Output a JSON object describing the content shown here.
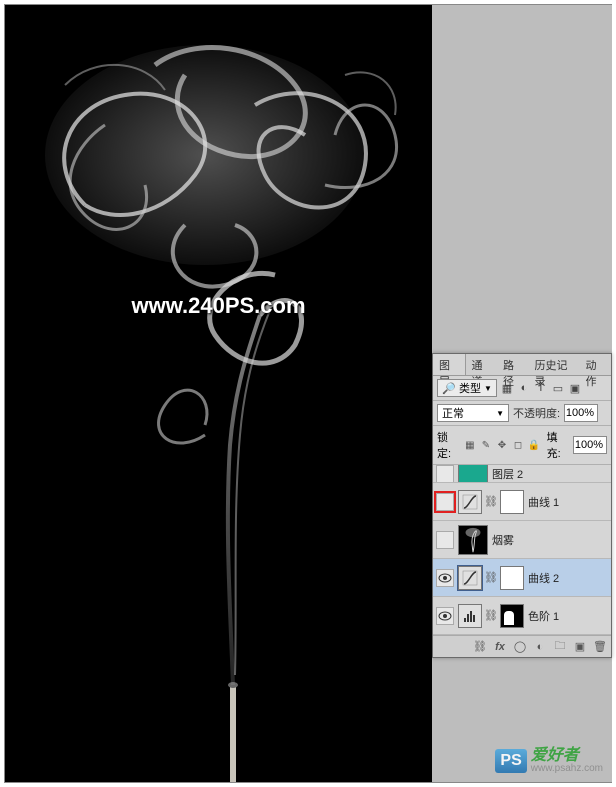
{
  "watermark": "www.240PS.com",
  "tabs": [
    "图层",
    "通道",
    "路径",
    "历史记录",
    "动作"
  ],
  "filter": {
    "label": "类型",
    "icons": [
      "image",
      "adjust",
      "text",
      "shape",
      "smart"
    ]
  },
  "blend": {
    "mode": "正常",
    "opacity_label": "不透明度:",
    "opacity_value": "100%"
  },
  "lock": {
    "label": "锁定:",
    "fill_label": "填充:",
    "fill_value": "100%"
  },
  "layers": [
    {
      "name": "图层 2",
      "visible": false,
      "type": "solid",
      "highlighted": false,
      "partial": true
    },
    {
      "name": "曲线 1",
      "visible": false,
      "type": "curves",
      "highlighted": true
    },
    {
      "name": "烟雾",
      "visible": false,
      "type": "smoke",
      "highlighted": false
    },
    {
      "name": "曲线 2",
      "visible": true,
      "type": "curves",
      "highlighted": false,
      "selected": true
    },
    {
      "name": "色阶 1",
      "visible": true,
      "type": "levels",
      "highlighted": false,
      "mask": "black"
    }
  ],
  "bottom_wm": {
    "badge": "PS",
    "cn": "爱好者",
    "url": "www.psahz.com"
  }
}
